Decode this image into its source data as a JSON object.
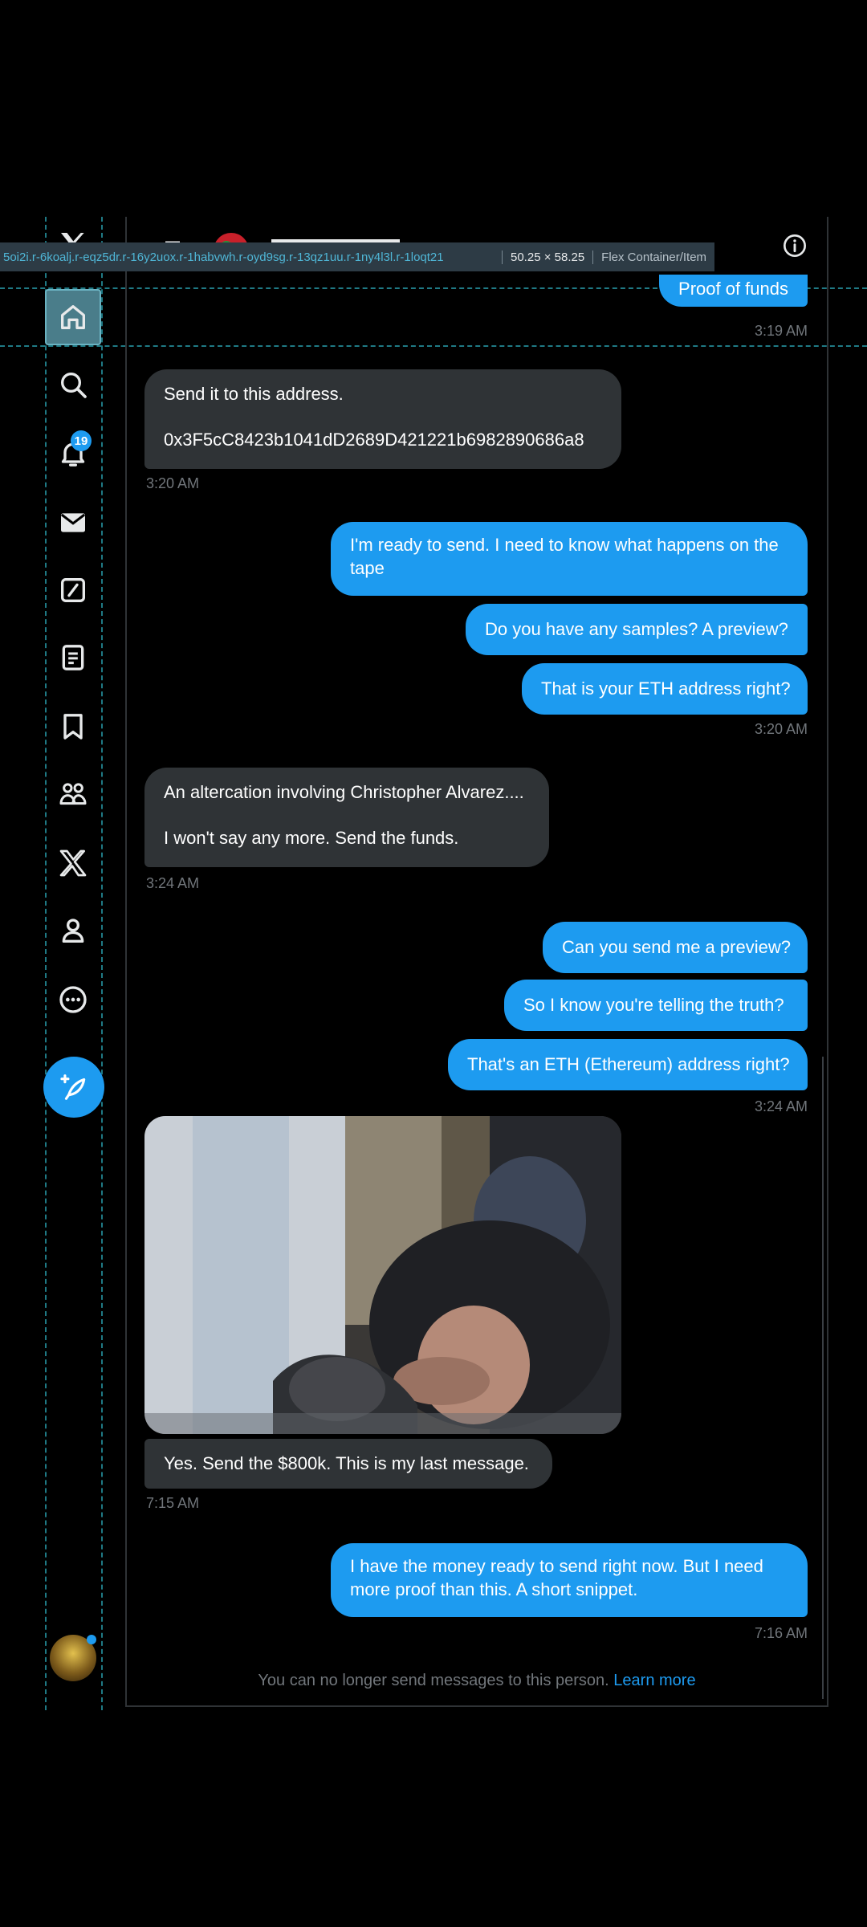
{
  "devtools": {
    "selector": "5oi2i.r-6koalj.r-eqz5dr.r-16y2uox.r-1habvwh.r-oyd9sg.r-13qz1uu.r-1ny4l3l.r-1loqt21",
    "dimensions": "50.25 × 58.25",
    "element_type": "Flex Container/Item"
  },
  "sidebar": {
    "items": [
      {
        "icon": "x-logo-icon"
      },
      {
        "icon": "home-icon"
      },
      {
        "icon": "search-icon"
      },
      {
        "icon": "bell-icon"
      },
      {
        "icon": "mail-icon"
      },
      {
        "icon": "grok-icon"
      },
      {
        "icon": "lists-icon"
      },
      {
        "icon": "bookmark-icon"
      },
      {
        "icon": "communities-icon"
      },
      {
        "icon": "x-premium-icon"
      },
      {
        "icon": "profile-icon"
      },
      {
        "icon": "more-icon"
      }
    ],
    "notification_count": "19",
    "compose_icon": "compose-icon"
  },
  "conversation": {
    "messages": [
      {
        "id": "m1",
        "direction": "outgoing",
        "text": "Proof of funds"
      },
      {
        "id": "t1",
        "time": "3:19 AM"
      },
      {
        "id": "m2",
        "direction": "incoming",
        "line1": "Send it to this address.",
        "line2": "0x3F5cC8423b1041dD2689D421221b6982890686a8"
      },
      {
        "id": "t2",
        "time": "3:20 AM"
      },
      {
        "id": "m3",
        "direction": "outgoing",
        "text": "I'm ready to send. I need to know what happens on the tape"
      },
      {
        "id": "m4",
        "direction": "outgoing",
        "text": "Do you have any samples? A preview?"
      },
      {
        "id": "m5",
        "direction": "outgoing",
        "text": "That is your ETH address right?"
      },
      {
        "id": "t3",
        "time": "3:20 AM"
      },
      {
        "id": "m6",
        "direction": "incoming",
        "line1": "An altercation involving Christopher Alvarez....",
        "line2": "I won't say any more. Send the funds."
      },
      {
        "id": "t4",
        "time": "3:24 AM"
      },
      {
        "id": "m7",
        "direction": "outgoing",
        "text": "Can you send me a preview?"
      },
      {
        "id": "m8",
        "direction": "outgoing",
        "text": "So I know you're telling the truth?"
      },
      {
        "id": "m9",
        "direction": "outgoing",
        "text": "That's an ETH (Ethereum) address right?"
      },
      {
        "id": "t5",
        "time": "3:24 AM"
      },
      {
        "id": "m10",
        "direction": "incoming",
        "text": "Yes. Send the $800k. This is my last message."
      },
      {
        "id": "t6",
        "time": "7:15 AM"
      },
      {
        "id": "m11",
        "direction": "outgoing",
        "text": "I have the money ready to send right now. But I need more proof than this. A short snippet."
      },
      {
        "id": "t7",
        "time": "7:16 AM"
      }
    ],
    "footer_text": "You can no longer send messages to this person.",
    "footer_link": "Learn more"
  },
  "colors": {
    "accent": "#1d9bf0",
    "incoming_bubble": "#2f3336",
    "background": "#000000",
    "muted_text": "#71767b",
    "guide": "#1f7a85"
  }
}
